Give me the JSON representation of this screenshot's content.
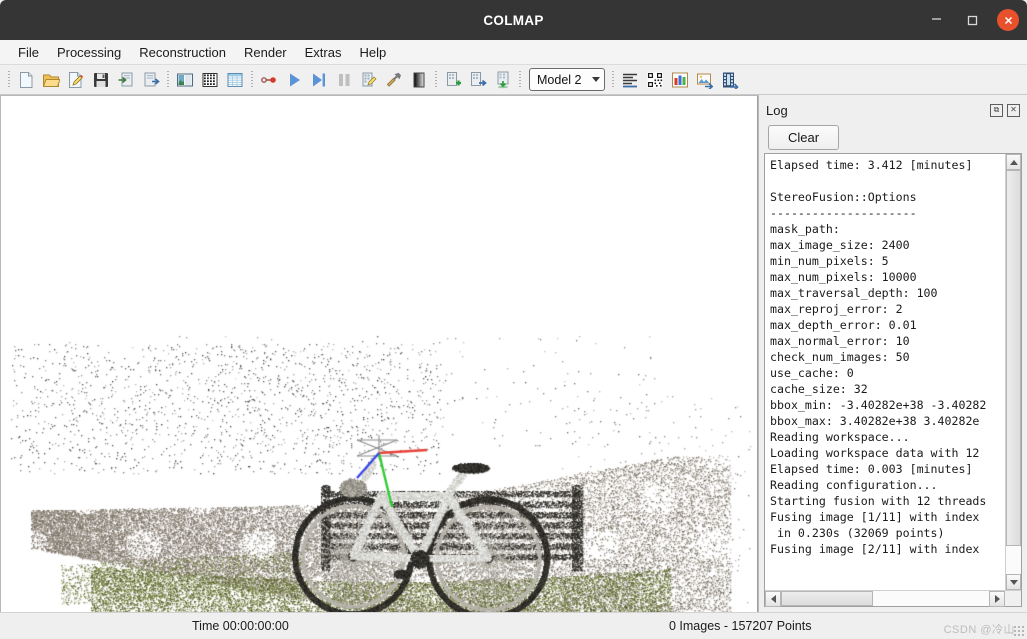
{
  "window": {
    "title": "COLMAP",
    "minimize_label": "–",
    "maximize_label": "□",
    "close_label": "✕"
  },
  "menubar": {
    "items": [
      {
        "label": "File",
        "name": "menu-file"
      },
      {
        "label": "Processing",
        "name": "menu-processing"
      },
      {
        "label": "Reconstruction",
        "name": "menu-reconstruction"
      },
      {
        "label": "Render",
        "name": "menu-render"
      },
      {
        "label": "Extras",
        "name": "menu-extras"
      },
      {
        "label": "Help",
        "name": "menu-help"
      }
    ]
  },
  "toolbar": {
    "model_selector_value": "Model 2",
    "buttons": [
      {
        "icon": "new-project-icon",
        "tip": "New project"
      },
      {
        "icon": "open-project-icon",
        "tip": "Open project"
      },
      {
        "icon": "edit-project-icon",
        "tip": "Edit project"
      },
      {
        "icon": "save-project-icon",
        "tip": "Save project"
      },
      {
        "icon": "import-model-icon",
        "tip": "Import model"
      },
      {
        "icon": "export-model-icon",
        "tip": "Export model"
      },
      {
        "icon": "feature-extraction-icon",
        "tip": "Feature extraction"
      },
      {
        "icon": "feature-matching-icon",
        "tip": "Feature matching"
      },
      {
        "icon": "database-management-icon",
        "tip": "Database management"
      },
      {
        "icon": "automatic-reconstruction-icon",
        "tip": "Automatic reconstruction"
      },
      {
        "icon": "start-reconstruction-icon",
        "tip": "Start reconstruction"
      },
      {
        "icon": "step-reconstruction-icon",
        "tip": "Reconstruct next image"
      },
      {
        "icon": "pause-reconstruction-icon",
        "tip": "Pause reconstruction"
      },
      {
        "icon": "bundle-adjustment-icon",
        "tip": "Bundle adjustment"
      },
      {
        "icon": "dense-reconstruction-icon",
        "tip": "Dense reconstruction"
      },
      {
        "icon": "render-options-icon",
        "tip": "Render options"
      },
      {
        "icon": "model-add-icon",
        "tip": "Add model"
      },
      {
        "icon": "model-next-icon",
        "tip": "Next model"
      },
      {
        "icon": "model-merge-icon",
        "tip": "Merge models"
      },
      {
        "icon": "show-log-icon",
        "tip": "Show log"
      },
      {
        "icon": "match-matrix-icon",
        "tip": "Match matrix"
      },
      {
        "icon": "statistics-icon",
        "tip": "Show model statistics"
      },
      {
        "icon": "undistort-icon",
        "tip": "Undistortion"
      },
      {
        "icon": "grab-movie-icon",
        "tip": "Grab movie"
      }
    ]
  },
  "log_panel": {
    "title": "Log",
    "float_label": "⧉",
    "close_label": "✕",
    "clear_button": "Clear",
    "lines": [
      "Elapsed time: 3.412 [minutes]",
      "",
      "StereoFusion::Options",
      "---------------------",
      "mask_path:",
      "max_image_size: 2400",
      "min_num_pixels: 5",
      "max_num_pixels: 10000",
      "max_traversal_depth: 100",
      "max_reproj_error: 2",
      "max_depth_error: 0.01",
      "max_normal_error: 10",
      "check_num_images: 50",
      "use_cache: 0",
      "cache_size: 32",
      "bbox_min: -3.40282e+38 -3.40282",
      "bbox_max: 3.40282e+38 3.40282e",
      "Reading workspace...",
      "Loading workspace data with 12",
      "Elapsed time: 0.003 [minutes]",
      "Reading configuration...",
      "Starting fusion with 12 threads",
      "Fusing image [1/11] with index",
      " in 0.230s (32069 points)",
      "Fusing image [2/11] with index"
    ]
  },
  "viewport": {
    "scene": "bicycle-point-cloud",
    "background_color": "#ffffff",
    "axis_colors": {
      "x": "#e8433a",
      "y": "#33cc33",
      "z": "#3a48e8"
    }
  },
  "statusbar": {
    "time": "Time 00:00:00:00",
    "points": "0 Images - 157207 Points",
    "watermark": "CSDN @冷山"
  }
}
